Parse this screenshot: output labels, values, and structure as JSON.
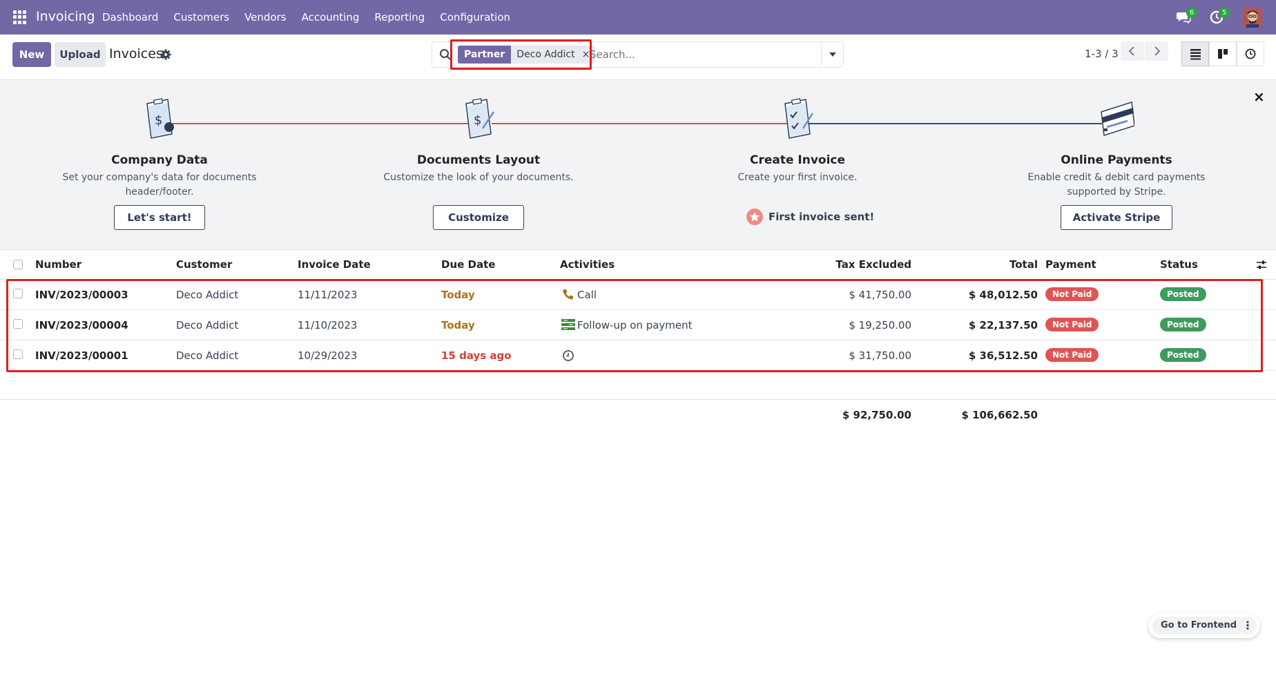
{
  "navbar": {
    "app_name": "Invoicing",
    "menu": [
      "Dashboard",
      "Customers",
      "Vendors",
      "Accounting",
      "Reporting",
      "Configuration"
    ],
    "messages_count": "6",
    "activities_count": "5",
    "color": "#7367a6"
  },
  "control_panel": {
    "new_label": "New",
    "upload_label": "Upload",
    "breadcrumb": "Invoices",
    "search": {
      "facet_label": "Partner",
      "facet_value": "Deco Addict",
      "facet_remove": "×",
      "placeholder": "Search..."
    },
    "pager": "1-3 / 3"
  },
  "onboarding": {
    "steps": [
      {
        "title": "Company Data",
        "description": "Set your company's data for documents header/footer.",
        "button": "Let's start!"
      },
      {
        "title": "Documents Layout",
        "description": "Customize the look of your documents.",
        "button": "Customize"
      },
      {
        "title": "Create Invoice",
        "description": "Create your first invoice.",
        "done_label": "First invoice sent!"
      },
      {
        "title": "Online Payments",
        "description": "Enable credit & debit card payments supported by Stripe.",
        "button": "Activate Stripe"
      }
    ],
    "close": "×"
  },
  "table": {
    "columns": {
      "number": "Number",
      "customer": "Customer",
      "invoice_date": "Invoice Date",
      "due_date": "Due Date",
      "activities": "Activities",
      "tax_excluded": "Tax Excluded",
      "total": "Total",
      "payment": "Payment",
      "status": "Status"
    },
    "rows": [
      {
        "number": "INV/2023/00003",
        "customer": "Deco Addict",
        "invoice_date": "11/11/2023",
        "due_date": "Today",
        "due_state": "today",
        "activity_icon": "phone-icon",
        "activity": "Call",
        "tax_excluded": "$ 41,750.00",
        "total": "$ 48,012.50",
        "payment": "Not Paid",
        "status": "Posted"
      },
      {
        "number": "INV/2023/00004",
        "customer": "Deco Addict",
        "invoice_date": "11/10/2023",
        "due_date": "Today",
        "due_state": "today",
        "activity_icon": "follow-up-icon",
        "activity": "Follow-up on payment",
        "tax_excluded": "$ 19,250.00",
        "total": "$ 22,137.50",
        "payment": "Not Paid",
        "status": "Posted"
      },
      {
        "number": "INV/2023/00001",
        "customer": "Deco Addict",
        "invoice_date": "10/29/2023",
        "due_date": "15 days ago",
        "due_state": "late",
        "activity_icon": "clock-icon",
        "activity": "",
        "tax_excluded": "$ 31,750.00",
        "total": "$ 36,512.50",
        "payment": "Not Paid",
        "status": "Posted"
      }
    ],
    "totals": {
      "tax_excluded": "$ 92,750.00",
      "total": "$ 106,662.50"
    }
  },
  "frontend": {
    "label": "Go to Frontend",
    "more": "⋮"
  }
}
